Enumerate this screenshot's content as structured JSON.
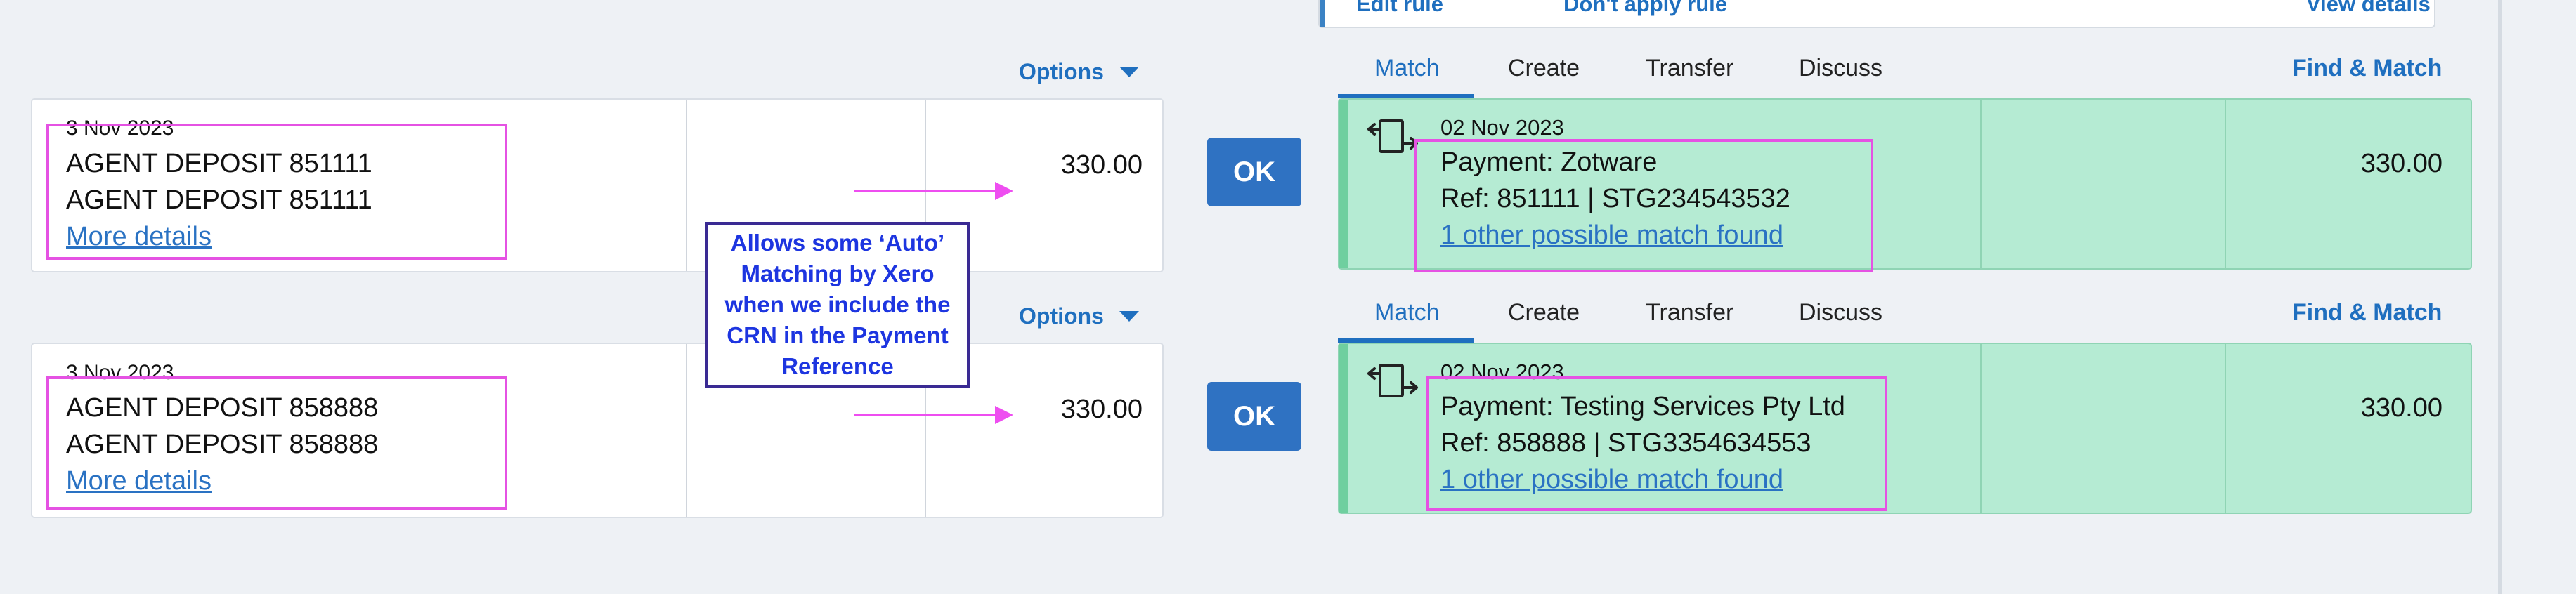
{
  "top_actions": {
    "edit_rule": "Edit rule",
    "dont_apply_rule": "Don't apply rule",
    "view_details": "View details"
  },
  "rows": [
    {
      "options_label": "Options",
      "statement": {
        "date": "3 Nov 2023",
        "line1": "AGENT DEPOSIT 851111",
        "line2": "AGENT DEPOSIT 851111",
        "more_details": "More details",
        "amount": "330.00"
      },
      "ok_label": "OK",
      "tabs": [
        "Match",
        "Create",
        "Transfer",
        "Discuss"
      ],
      "active_tab": "Match",
      "find_match": "Find & Match",
      "match": {
        "date": "02 Nov 2023",
        "payment": "Payment: Zotware",
        "ref": "Ref: 851111 | STG234543532",
        "possible_match": "1 other possible match found",
        "amount": "330.00"
      }
    },
    {
      "options_label": "Options",
      "statement": {
        "date": "3 Nov 2023",
        "line1": "AGENT DEPOSIT 858888",
        "line2": "AGENT DEPOSIT 858888",
        "more_details": "More details",
        "amount": "330.00"
      },
      "ok_label": "OK",
      "tabs": [
        "Match",
        "Create",
        "Transfer",
        "Discuss"
      ],
      "active_tab": "Match",
      "find_match": "Find & Match",
      "match": {
        "date": "02 Nov 2023",
        "payment": "Payment: Testing Services Pty Ltd",
        "ref": "Ref: 858888 | STG3354634553",
        "possible_match": "1 other possible match found",
        "amount": "330.00"
      }
    }
  ],
  "annotation": {
    "lines": [
      "Allows some ‘Auto’",
      "Matching by Xero",
      "when we include the",
      "CRN in the Payment",
      "Reference"
    ]
  },
  "colors": {
    "accent": "#1f6fbf",
    "ok_button": "#2f72c2",
    "match_green": "#b5ebd3",
    "annotation_pink": "#e552e3",
    "note_text": "#1d35e0"
  },
  "icons": {
    "transfer": "transfer-arrows-icon",
    "options": "caret-down-icon"
  }
}
